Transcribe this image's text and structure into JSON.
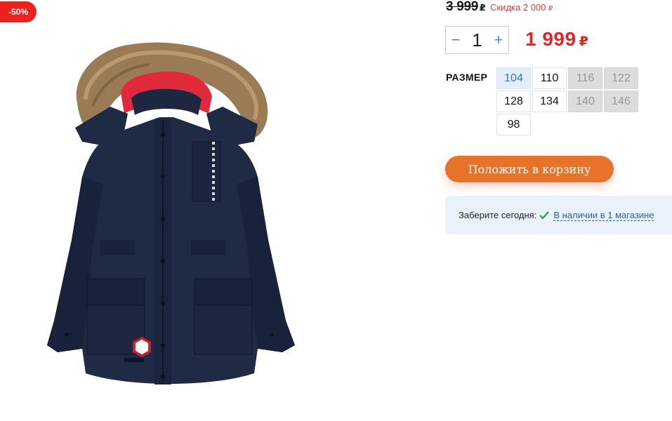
{
  "badge": {
    "discount_percent": "-50%"
  },
  "pricing": {
    "old_price": "3 999",
    "currency": "₽",
    "discount_label": "Скидка 2 000",
    "new_price": "1 999",
    "price_color": "#e02525"
  },
  "quantity": {
    "minus": "−",
    "value": "1",
    "plus": "+"
  },
  "size": {
    "label": "РАЗМЕР",
    "options": [
      {
        "value": "104",
        "state": "selected"
      },
      {
        "value": "110",
        "state": "available"
      },
      {
        "value": "116",
        "state": "unavailable"
      },
      {
        "value": "122",
        "state": "unavailable"
      },
      {
        "value": "128",
        "state": "available"
      },
      {
        "value": "134",
        "state": "available"
      },
      {
        "value": "140",
        "state": "unavailable"
      },
      {
        "value": "146",
        "state": "unavailable"
      },
      {
        "value": "98",
        "state": "available"
      }
    ]
  },
  "cart": {
    "button_label": "Положить в корзину",
    "button_color": "#e7732a"
  },
  "pickup": {
    "label": "Заберите сегодня:",
    "check_icon": "checkmark-icon",
    "availability_link": "В наличии в 1 магазине"
  },
  "product_image": {
    "subject": "jacket-photo"
  }
}
